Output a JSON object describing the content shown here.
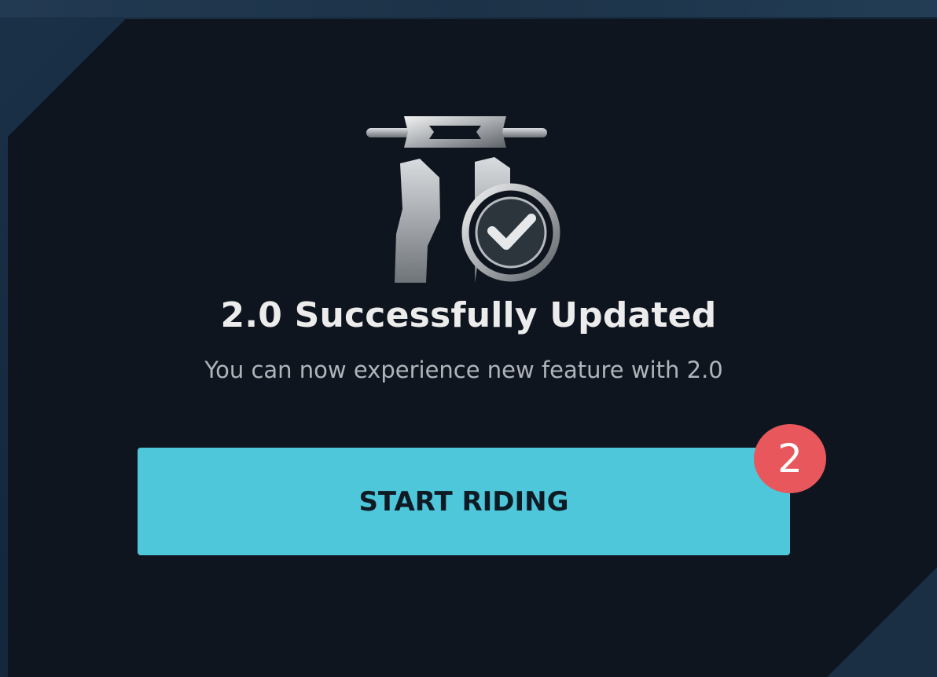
{
  "dialog": {
    "title": "2.0 Successfully Updated",
    "subtitle": "You can now experience new feature with 2.0",
    "primary_button_label": "START RIDING",
    "step_badge": "2",
    "icon": "scooter-handlebar-check-icon"
  },
  "colors": {
    "panel_background": "#0f151e",
    "accent_button": "#4ec7db",
    "badge": "#e8575b"
  }
}
